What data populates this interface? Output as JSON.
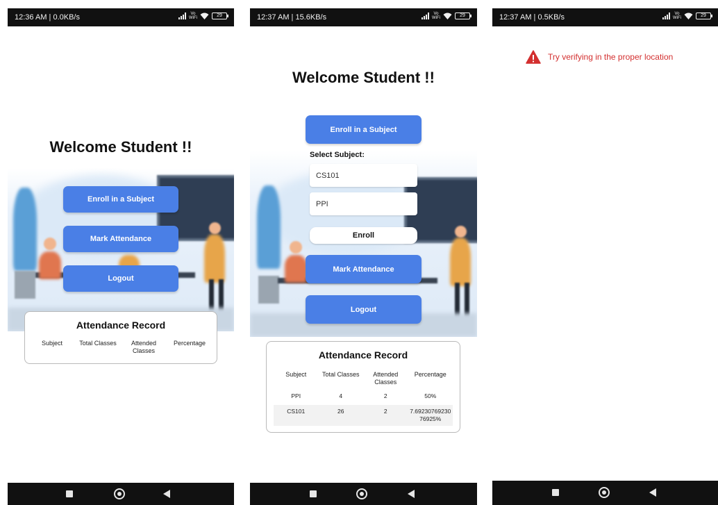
{
  "screen1": {
    "status": {
      "time": "12:36 AM | 0.0KB/s",
      "battery": "29"
    },
    "welcome": "Welcome Student !!",
    "buttons": {
      "enroll": "Enroll in a Subject",
      "mark": "Mark Attendance",
      "logout": "Logout"
    },
    "record": {
      "title": "Attendance Record",
      "headers": [
        "Subject",
        "Total Classes",
        "Attended Classes",
        "Percentage"
      ]
    }
  },
  "screen2": {
    "status": {
      "time": "12:37 AM | 15.6KB/s",
      "battery": "29"
    },
    "welcome": "Welcome Student !!",
    "buttons": {
      "enroll": "Enroll in a Subject",
      "mark": "Mark Attendance",
      "logout": "Logout"
    },
    "select_label": "Select Subject:",
    "options": [
      "CS101",
      "PPI"
    ],
    "enroll_label": "Enroll",
    "record": {
      "title": "Attendance Record",
      "headers": [
        "Subject",
        "Total Classes",
        "Attended Classes",
        "Percentage"
      ],
      "rows": [
        [
          "PPI",
          "4",
          "2",
          "50%"
        ],
        [
          "CS101",
          "26",
          "2",
          "7.69230769230 76925%"
        ]
      ]
    }
  },
  "screen3": {
    "status": {
      "time": "12:37 AM | 0.5KB/s",
      "battery": "29"
    },
    "alert": "Try verifying in the proper location"
  },
  "colors": {
    "primary_button": "#4a7fe6",
    "alert_red": "#d32f2f",
    "bar_dark": "#111111"
  },
  "icons": [
    "status-signal-icon",
    "wifi-icon",
    "battery-icon",
    "recent-apps-icon",
    "home-icon",
    "back-icon",
    "warning-icon"
  ]
}
